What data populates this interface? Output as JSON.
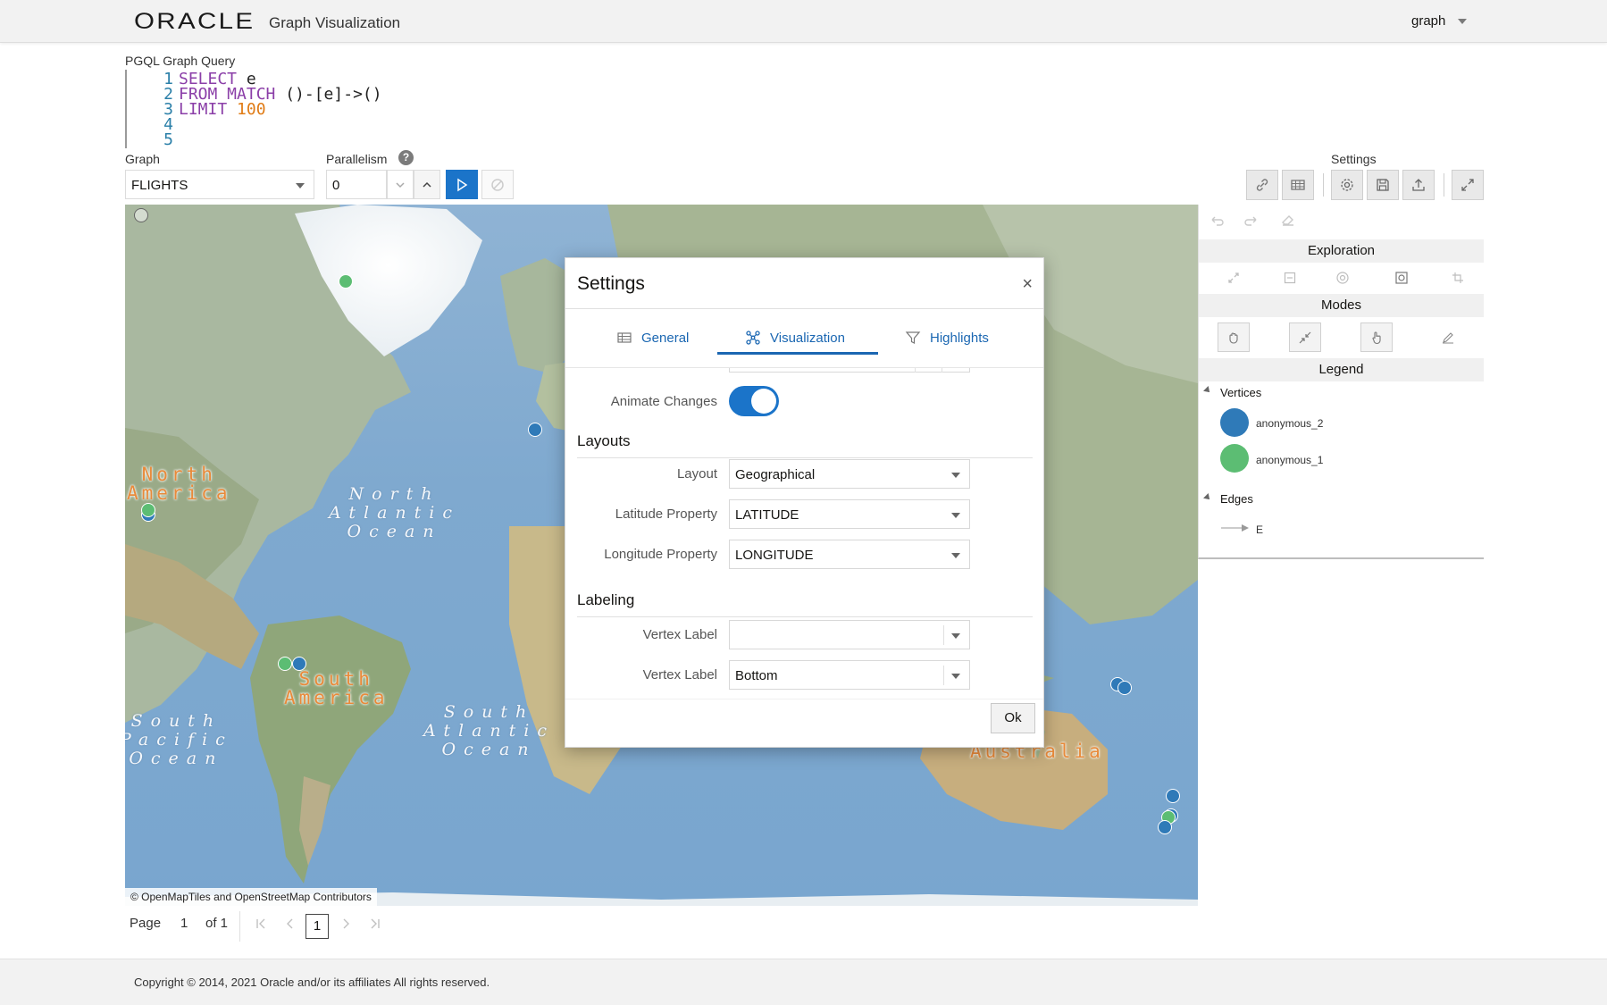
{
  "header": {
    "logo": "ORACLE",
    "app_title": "Graph Visualization",
    "user": "graph"
  },
  "query": {
    "label": "PGQL Graph Query",
    "lines": [
      {
        "num": "1",
        "kw": "SELECT",
        "rest": " e"
      },
      {
        "num": "2",
        "kw": "FROM MATCH",
        "rest": " ()-[e]->()"
      },
      {
        "num": "3",
        "kw": "LIMIT",
        "num_val": "100"
      },
      {
        "num": "4"
      },
      {
        "num": "5"
      }
    ]
  },
  "controls": {
    "graph_label": "Graph",
    "graph_value": "FLIGHTS",
    "parallelism_label": "Parallelism",
    "parallelism_value": "0",
    "help": "?",
    "settings_label": "Settings"
  },
  "map": {
    "attribution": "© OpenMapTiles and OpenStreetMap Contributors",
    "labels": {
      "north_america": "North\nAmerica",
      "south_america": "South\nAmerica",
      "australia": "Australia",
      "north_atlantic": "North\nAtlantic\nOcean",
      "south_atlantic": "South\nAtlantic\nOcean",
      "south_pacific": "South\nPacific\nOcean"
    }
  },
  "right_panel": {
    "exploration": "Exploration",
    "modes": "Modes",
    "legend": "Legend",
    "vertices_title": "Vertices",
    "vertices": [
      {
        "label": "anonymous_2",
        "color": "#2f7ab8"
      },
      {
        "label": "anonymous_1",
        "color": "#5cbd73"
      }
    ],
    "edges_title": "Edges",
    "edges": [
      {
        "label": "E"
      }
    ]
  },
  "pagination": {
    "page_label": "Page",
    "page_current": "1",
    "of_label": "of 1",
    "page_input": "1"
  },
  "footer": {
    "copyright": "Copyright © 2014, 2021 Oracle and/or its affiliates All rights reserved."
  },
  "modal": {
    "title": "Settings",
    "close": "×",
    "tabs": [
      {
        "label": "General",
        "active": false
      },
      {
        "label": "Visualization",
        "active": true
      },
      {
        "label": "Highlights",
        "active": false
      }
    ],
    "animate_label": "Animate Changes",
    "animate_on": true,
    "layouts_heading": "Layouts",
    "layout_label": "Layout",
    "layout_value": "Geographical",
    "latitude_label": "Latitude Property",
    "latitude_value": "LATITUDE",
    "longitude_label": "Longitude Property",
    "longitude_value": "LONGITUDE",
    "labeling_heading": "Labeling",
    "vertex_label_label": "Vertex Label",
    "vertex_label_value": "",
    "vertex_label_pos_label": "Vertex Label",
    "vertex_label_pos_value": "Bottom",
    "ok": "Ok"
  },
  "colors": {
    "accent": "#1b74c9",
    "vertex_blue": "#2f7ab8",
    "vertex_green": "#5cbd73"
  }
}
